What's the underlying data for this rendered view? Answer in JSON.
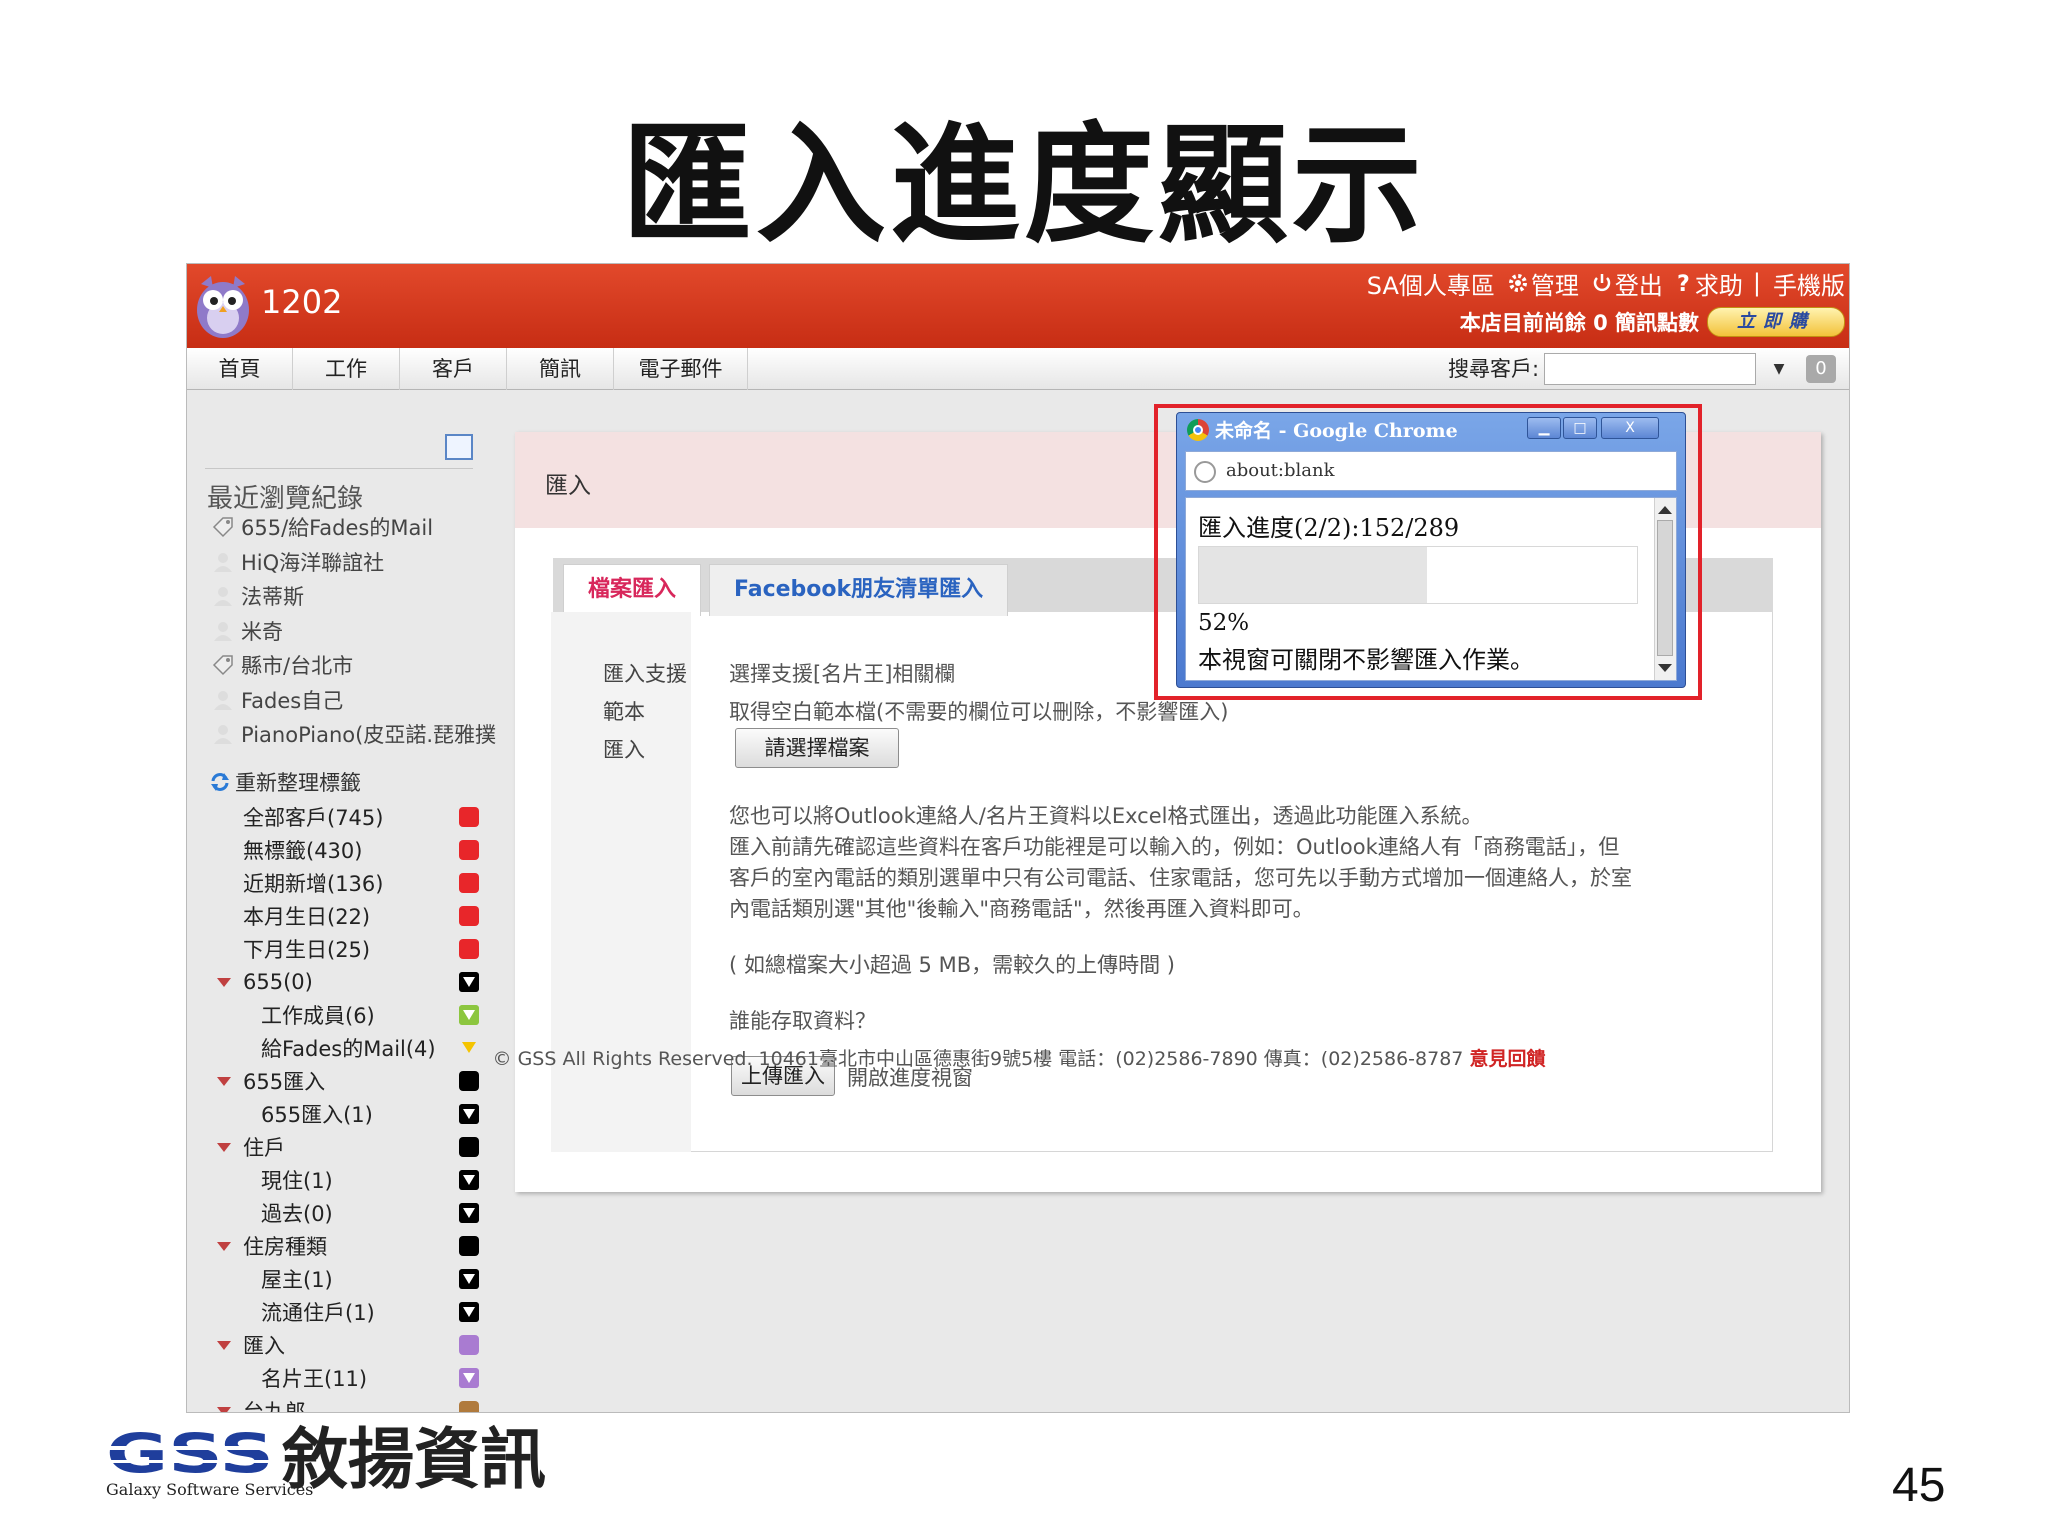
{
  "slide": {
    "title": "匯入進度顯示",
    "page_number": "45",
    "company_name": "敘揚資訊",
    "logo_text": "GSS",
    "logo_subtext": "Galaxy Software Services"
  },
  "header": {
    "app_title": "1202",
    "links": [
      "SA個人專區",
      "管理",
      "登出",
      "求助",
      "手機版"
    ],
    "link_separator": "|",
    "sms_text": "本店目前尚餘 0 簡訊點數",
    "buy_label": "立即購"
  },
  "nav": {
    "tabs": [
      "首頁",
      "工作",
      "客戶",
      "簡訊",
      "電子郵件"
    ],
    "search_label": "搜尋客戶:",
    "search_value": "",
    "search_go_label": "0",
    "dropdown_glyph": "▼"
  },
  "sidebar": {
    "recent_title": "最近瀏覽紀錄",
    "recent_items": [
      {
        "label": "655/給Fades的Mail",
        "icon": "tag-icon"
      },
      {
        "label": "HiQ海洋聯誼社",
        "icon": "person-icon"
      },
      {
        "label": "法蒂斯",
        "icon": "person-icon"
      },
      {
        "label": "米奇",
        "icon": "person-icon"
      },
      {
        "label": "縣市/台北市",
        "icon": "tag-icon"
      },
      {
        "label": "Fades自己",
        "icon": "person-icon"
      },
      {
        "label": "PianoPiano(皮亞諾.琵雅撲",
        "icon": "person-icon"
      }
    ],
    "reorganize_label": "重新整理標籤",
    "tags": [
      {
        "label": "全部客戶(745)",
        "color": "#e8262a",
        "kind": "solid",
        "indent": 0,
        "arrow": false
      },
      {
        "label": "無標籤(430)",
        "color": "#e8262a",
        "kind": "solid",
        "indent": 0,
        "arrow": false
      },
      {
        "label": "近期新增(136)",
        "color": "#e8262a",
        "kind": "solid",
        "indent": 0,
        "arrow": false
      },
      {
        "label": "本月生日(22)",
        "color": "#e8262a",
        "kind": "solid",
        "indent": 0,
        "arrow": false
      },
      {
        "label": "下月生日(25)",
        "color": "#e8262a",
        "kind": "solid",
        "indent": 0,
        "arrow": false
      },
      {
        "label": "655(0)",
        "color": "#000000",
        "kind": "filter",
        "indent": 0,
        "arrow": true
      },
      {
        "label": "工作成員(6)",
        "color": "#8cc63f",
        "kind": "filter",
        "indent": 1,
        "arrow": false
      },
      {
        "label": "給Fades的Mail(4)",
        "color": "#f5c400",
        "kind": "filter-plain",
        "indent": 1,
        "arrow": false
      },
      {
        "label": "655匯入",
        "color": "#000000",
        "kind": "solid",
        "indent": 0,
        "arrow": true
      },
      {
        "label": "655匯入(1)",
        "color": "#000000",
        "kind": "filter",
        "indent": 1,
        "arrow": false
      },
      {
        "label": "住戶",
        "color": "#000000",
        "kind": "solid",
        "indent": 0,
        "arrow": true
      },
      {
        "label": "現住(1)",
        "color": "#000000",
        "kind": "filter",
        "indent": 1,
        "arrow": false
      },
      {
        "label": "過去(0)",
        "color": "#000000",
        "kind": "filter",
        "indent": 1,
        "arrow": false
      },
      {
        "label": "住房種類",
        "color": "#000000",
        "kind": "solid",
        "indent": 0,
        "arrow": true
      },
      {
        "label": "屋主(1)",
        "color": "#000000",
        "kind": "filter",
        "indent": 1,
        "arrow": false
      },
      {
        "label": "流通住戶(1)",
        "color": "#000000",
        "kind": "filter",
        "indent": 1,
        "arrow": false
      },
      {
        "label": "匯入",
        "color": "#a97bd1",
        "kind": "solid",
        "indent": 0,
        "arrow": true
      },
      {
        "label": "名片王(11)",
        "color": "#a97bd1",
        "kind": "filter",
        "indent": 1,
        "arrow": false
      },
      {
        "label": "台九郎",
        "color": "#b07a3c",
        "kind": "solid",
        "indent": 0,
        "arrow": true
      }
    ]
  },
  "content": {
    "heading": "匯入",
    "tabs": [
      "檔案匯入",
      "Facebook朋友清單匯入"
    ],
    "labels": [
      "匯入支援",
      "範本",
      "匯入"
    ],
    "support_text": "選擇支援[名片王]相關欄",
    "template_text": "取得空白範本檔(不需要的欄位可以刪除，不影響匯入)",
    "choose_file_label": "請選擇檔案",
    "description_lines": [
      "您也可以將Outlook連絡人/名片王資料以Excel格式匯出，透過此功能匯入系統。",
      "匯入前請先確認這些資料在客戶功能裡是可以輸入的，例如：Outlook連絡人有「商務電話」，但",
      "客戶的室內電話的類別選單中只有公司電話、住家電話，您可先以手動方式增加一個連絡人，於室",
      "內電話類別選\"其他\"後輸入\"商務電話\"，然後再匯入資料即可。"
    ],
    "size_note": "( 如總檔案大小超過 5 MB，需較久的上傳時間 )",
    "access_question": "誰能存取資料？",
    "upload_label": "上傳匯入",
    "open_progress_label": "開啟進度視窗"
  },
  "footer": {
    "text": "© GSS All Rights Reserved. 10461臺北市中山區德惠街9號5樓 電話：(02)2586-7890 傳真：(02)2586-8787",
    "feedback_label": "意見回饋"
  },
  "popup": {
    "title": "未命名 - Google Chrome",
    "address": "about:blank",
    "progress_label": "匯入進度(2/2):152/289",
    "progress_fraction": 0.52,
    "percent_text": "52%",
    "note": "本視窗可關閉不影響匯入作業。",
    "minimize_glyph": "▁",
    "maximize_glyph": "□",
    "close_glyph": "X"
  },
  "colors": {
    "header_red": "#d23a1e",
    "accent_pink": "#d8275b",
    "accent_blue": "#2a63c0",
    "highlight_red": "#e2222a"
  }
}
